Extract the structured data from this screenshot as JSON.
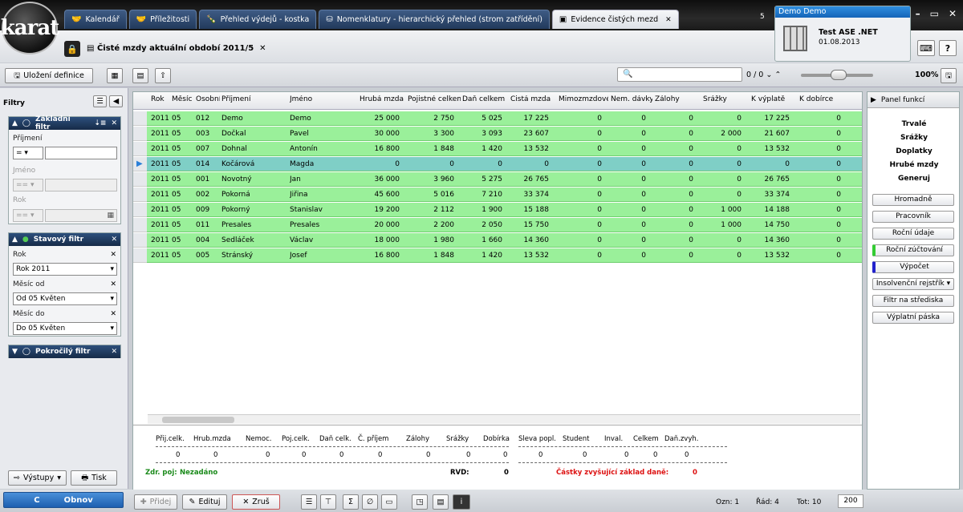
{
  "app": {
    "logo": "karat"
  },
  "tabs": [
    {
      "label": "Kalendář",
      "icon": "handshake-icon"
    },
    {
      "label": "Příležitosti",
      "icon": "handshake-icon"
    },
    {
      "label": "Přehled výdejů - kostka",
      "icon": "bottle-icon"
    },
    {
      "label": "Nomenklatury - hierarchický přehled (strom zatřídění)",
      "icon": "cubes-icon"
    },
    {
      "label": "Evidence čistých mezd",
      "icon": "folder-icon",
      "active": true
    }
  ],
  "window": {
    "badge": "5",
    "minimize": "–",
    "restore": "▭",
    "close": "✕"
  },
  "user": {
    "header": "Demo Demo",
    "company": "Test ASE .NET",
    "date": "01.08.2013"
  },
  "document": {
    "title": "Čisté mzdy aktuální období 2011/5",
    "close": "✕"
  },
  "toolbar": {
    "save_definition": "Uložení definice",
    "counter": "0 / 0",
    "zoom": "100%",
    "search_placeholder": ""
  },
  "filters": {
    "title": "Filtry",
    "basic": {
      "title": "Základní filtr",
      "fields": [
        {
          "label": "Příjmení",
          "op": "=",
          "value": "",
          "disabled": false
        },
        {
          "label": "Jméno",
          "op": "==",
          "value": "",
          "disabled": true
        },
        {
          "label": "Rok",
          "op": "==",
          "value": "",
          "disabled": true
        }
      ]
    },
    "status": {
      "title": "Stavový filtr",
      "fields": [
        {
          "label": "Rok",
          "value": "Rok  2011"
        },
        {
          "label": "Měsíc od",
          "value": "Od 05 Květen"
        },
        {
          "label": "Měsíc do",
          "value": "Do 05 Květen"
        }
      ]
    },
    "advanced": {
      "title": "Pokročilý filtr"
    }
  },
  "table": {
    "columns": [
      "Rok",
      "Měsíc",
      "Osobní",
      "Příjmení",
      "Jméno",
      "Hrubá mzda",
      "Pojistné celkem",
      "Daň celkem",
      "Čistá mzda",
      "Mimozmzdové",
      "Nem. dávky",
      "Zálohy",
      "Srážky",
      "K výplatě",
      "K dobírce"
    ],
    "rows": [
      [
        "2011",
        "05",
        "012",
        "Demo",
        "Demo",
        "25 000",
        "2 750",
        "5 025",
        "17 225",
        "0",
        "0",
        "0",
        "0",
        "17 225",
        "0"
      ],
      [
        "2011",
        "05",
        "003",
        "Dočkal",
        "Pavel",
        "30 000",
        "3 300",
        "3 093",
        "23 607",
        "0",
        "0",
        "0",
        "2 000",
        "21 607",
        "0"
      ],
      [
        "2011",
        "05",
        "007",
        "Dohnal",
        "Antonín",
        "16 800",
        "1 848",
        "1 420",
        "13 532",
        "0",
        "0",
        "0",
        "0",
        "13 532",
        "0"
      ],
      [
        "2011",
        "05",
        "014",
        "Kočárová",
        "Magda",
        "0",
        "0",
        "0",
        "0",
        "0",
        "0",
        "0",
        "0",
        "0",
        "0"
      ],
      [
        "2011",
        "05",
        "001",
        "Novotný",
        "Jan",
        "36 000",
        "3 960",
        "5 275",
        "26 765",
        "0",
        "0",
        "0",
        "0",
        "26 765",
        "0"
      ],
      [
        "2011",
        "05",
        "002",
        "Pokorná",
        "Jiřina",
        "45 600",
        "5 016",
        "7 210",
        "33 374",
        "0",
        "0",
        "0",
        "0",
        "33 374",
        "0"
      ],
      [
        "2011",
        "05",
        "009",
        "Pokorný",
        "Stanislav",
        "19 200",
        "2 112",
        "1 900",
        "15 188",
        "0",
        "0",
        "0",
        "1 000",
        "14 188",
        "0"
      ],
      [
        "2011",
        "05",
        "011",
        "Presales",
        "Presales",
        "20 000",
        "2 200",
        "2 050",
        "15 750",
        "0",
        "0",
        "0",
        "1 000",
        "14 750",
        "0"
      ],
      [
        "2011",
        "05",
        "004",
        "Sedláček",
        "Václav",
        "18 000",
        "1 980",
        "1 660",
        "14 360",
        "0",
        "0",
        "0",
        "0",
        "14 360",
        "0"
      ],
      [
        "2011",
        "05",
        "005",
        "Stránský",
        "Josef",
        "16 800",
        "1 848",
        "1 420",
        "13 532",
        "0",
        "0",
        "0",
        "0",
        "13 532",
        "0"
      ]
    ],
    "selected_row": 3
  },
  "summary": {
    "labels": [
      "Přij.celk.",
      "Hrub.mzda",
      "Nemoc.",
      "Poj.celk.",
      "Daň celk.",
      "Č. příjem",
      "Zálohy",
      "Srážky",
      "Dobírka",
      "Sleva popl.",
      "Student",
      "Inval.",
      "Celkem",
      "Daň.zvyh."
    ],
    "values": [
      "0",
      "0",
      "0",
      "0",
      "0",
      "0",
      "0",
      "0",
      "0",
      "0",
      "0",
      "0",
      "0",
      "0"
    ],
    "zdr_label": "Zdr. poj:",
    "zdr_value": "Nezadáno",
    "rvd_label": "RVD:",
    "rvd_value": "0",
    "castky_label": "Částky zvyšující základ daně:",
    "castky_value": "0"
  },
  "right_panel": {
    "title": "Panel funkcí",
    "labels": [
      "Trvalé",
      "Srážky",
      "Doplatky",
      "Hrubé mzdy",
      "Generuj"
    ],
    "buttons": [
      "Hromadně",
      "Pracovník",
      "Roční údaje",
      "Roční zúčtování",
      "Výpočet",
      "Insolvenční rejstřík",
      "Filtr na střediska",
      "Výplatní páska"
    ]
  },
  "bottom": {
    "vystupy": "Výstupy",
    "tisk": "Tisk",
    "obnov": "Obnov",
    "pridej": "Přidej",
    "edituj": "Edituj",
    "zrus": "Zruš",
    "ozn": "Ozn: 1",
    "rad": "Řád: 4",
    "tot": "Tot: 10",
    "page_size": "200"
  }
}
